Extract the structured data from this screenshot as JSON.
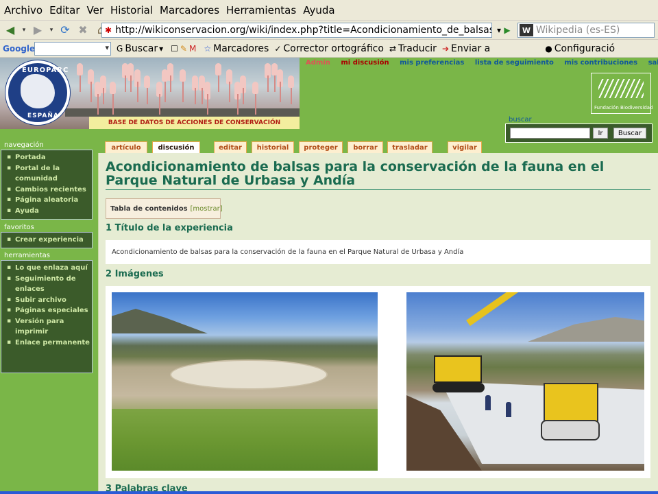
{
  "browser": {
    "menu": [
      "Archivo",
      "Editar",
      "Ver",
      "Historial",
      "Marcadores",
      "Herramientas",
      "Ayuda"
    ],
    "url": "http://wikiconservacion.org/wiki/index.php?title=Acondicionamiento_de_balsas",
    "search_placeholder": "Wikipedia (es-ES)",
    "search_engine_badge": "W",
    "google_toolbar": {
      "logo": "Google",
      "items": [
        "Buscar",
        "Marcadores",
        "Corrector ortográfico",
        "Traducir",
        "Enviar a",
        "Configuració"
      ]
    }
  },
  "banner": {
    "logo_top": "EUROPARC",
    "logo_bottom": "ESPAÑA",
    "strip": "BASE DE DATOS DE ACCIONES DE CONSERVACIÓN"
  },
  "user_links": [
    "Admin",
    "mi discusión",
    "mis preferencias",
    "lista de seguimiento",
    "mis contribuciones",
    "salir"
  ],
  "fundacion_label": "Fundación Biodiversidad",
  "search": {
    "label": "buscar",
    "go": "Ir",
    "search": "Buscar"
  },
  "sidebar": {
    "navegacion": {
      "title": "navegación",
      "items": [
        "Portada",
        "Portal de la comunidad",
        "Cambios recientes",
        "Página aleatoria",
        "Ayuda"
      ]
    },
    "favoritos": {
      "title": "favoritos",
      "items": [
        "Crear experiencia"
      ]
    },
    "herramientas": {
      "title": "herramientas",
      "items": [
        "Lo que enlaza aquí",
        "Seguimiento de enlaces",
        "Subir archivo",
        "Páginas especiales",
        "Versión para imprimir",
        "Enlace permanente"
      ]
    }
  },
  "tabs": [
    "artículo",
    "discusión",
    "editar",
    "historial",
    "proteger",
    "borrar",
    "trasladar",
    "vigilar"
  ],
  "content": {
    "title": "Acondicionamiento de balsas para la conservación de la fauna en el Parque Natural de Urbasa y Andía",
    "toc": {
      "label": "Tabla de contenidos",
      "toggle": "[mostrar]"
    },
    "sections": [
      {
        "number": "1",
        "title": "Título de la experiencia",
        "text": "Acondicionamiento de balsas para la conservación de la fauna en el Parque Natural de Urbasa y Andía"
      },
      {
        "number": "2",
        "title": "Imágenes"
      },
      {
        "number": "3",
        "title": "Palabras clave"
      }
    ]
  }
}
